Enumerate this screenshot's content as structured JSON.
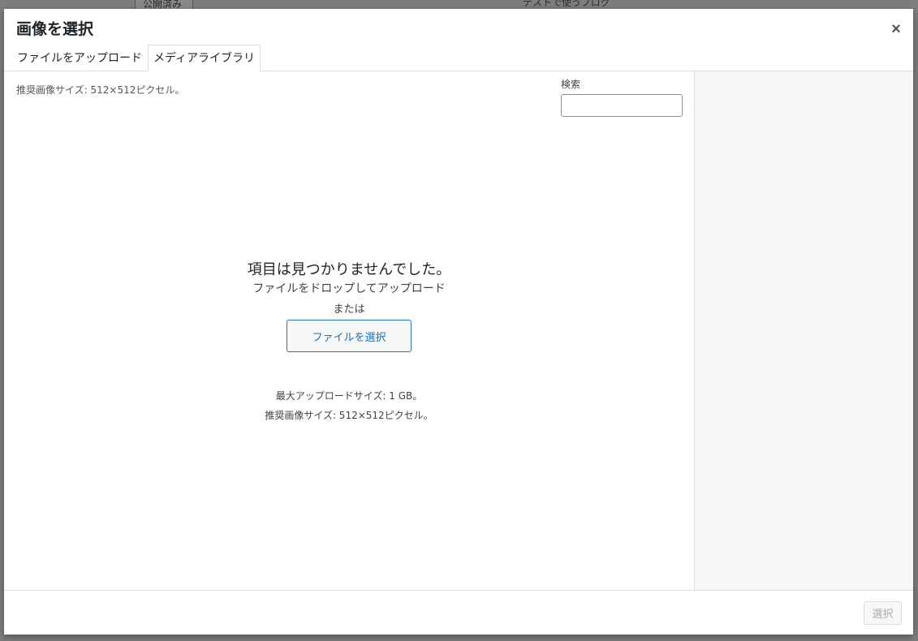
{
  "modal": {
    "title": "画像を選択",
    "close_label": "×"
  },
  "tabs": [
    {
      "label": "ファイルをアップロード",
      "active": false
    },
    {
      "label": "メディアライブラリ",
      "active": true
    }
  ],
  "content": {
    "recommended_size_top": "推奨画像サイズ: 512×512ピクセル。",
    "search_label": "検索",
    "search_value": "",
    "empty_title": "項目は見つかりませんでした。",
    "drop_text": "ファイルをドロップしてアップロード",
    "or_text": "または",
    "select_file_label": "ファイルを選択",
    "max_upload": "最大アップロードサイズ: 1 GB。",
    "recommended_size_bottom": "推奨画像サイズ: 512×512ピクセル。"
  },
  "footer": {
    "select_label": "選択",
    "select_disabled": true
  },
  "background": {
    "snippet_top_left": "公開済み",
    "snippet_top_center": "テストで使うブログ"
  },
  "colors": {
    "accent": "#2271b1",
    "sidebar_bg": "#f6f7f7",
    "border": "#dcdcde"
  }
}
